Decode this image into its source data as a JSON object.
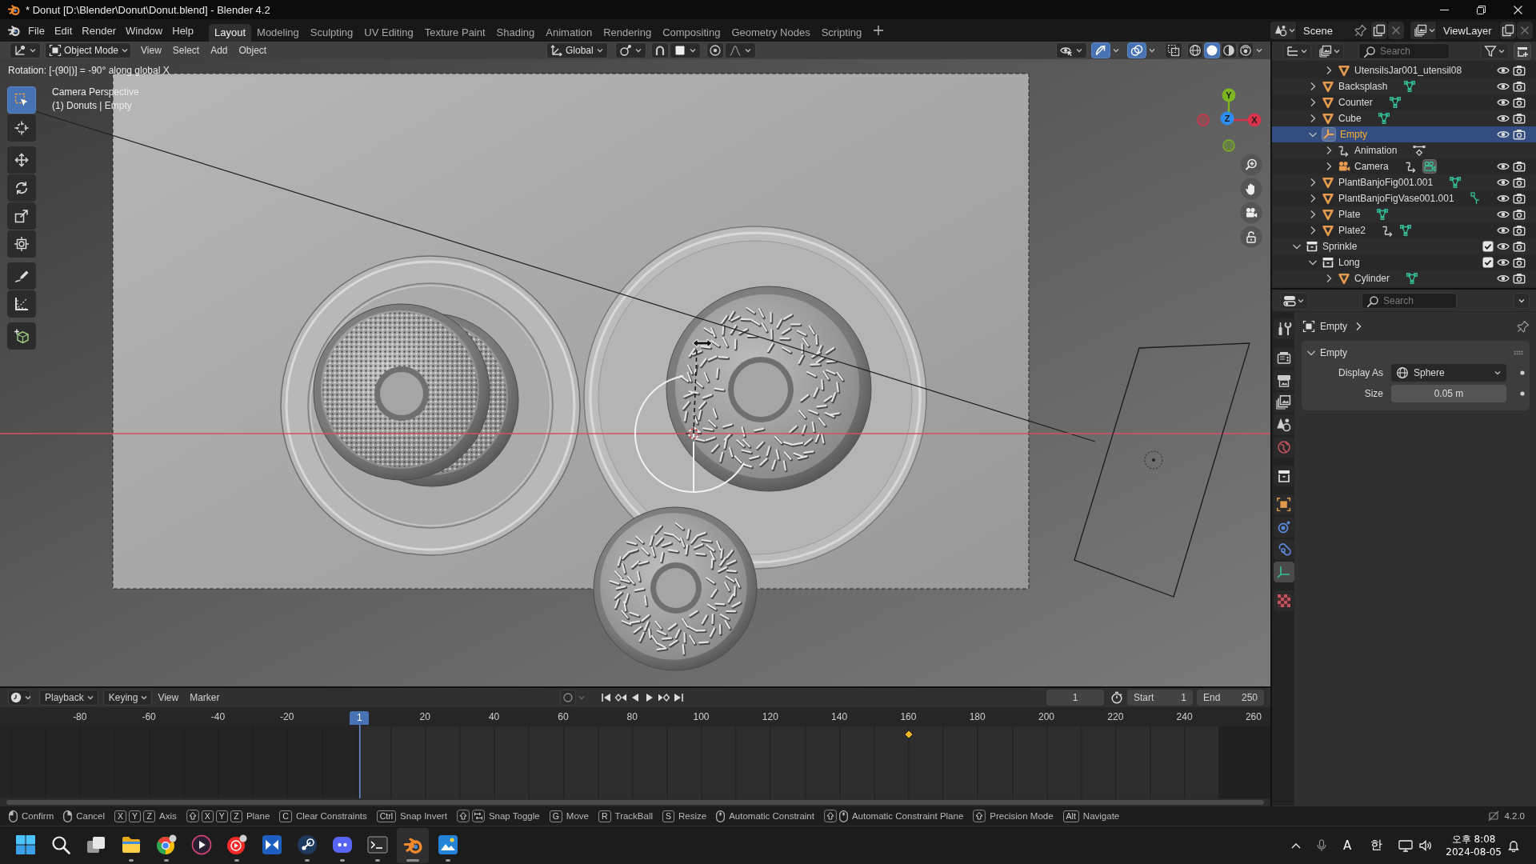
{
  "window": {
    "title": "* Donut [D:\\Blender\\Donut\\Donut.blend] - Blender 4.2"
  },
  "menu": [
    "File",
    "Edit",
    "Render",
    "Window",
    "Help"
  ],
  "workspaces": [
    {
      "label": "Layout",
      "selected": true
    },
    {
      "label": "Modeling",
      "selected": false
    },
    {
      "label": "Sculpting",
      "selected": false
    },
    {
      "label": "UV Editing",
      "selected": false
    },
    {
      "label": "Texture Paint",
      "selected": false
    },
    {
      "label": "Shading",
      "selected": false
    },
    {
      "label": "Animation",
      "selected": false
    },
    {
      "label": "Rendering",
      "selected": false
    },
    {
      "label": "Compositing",
      "selected": false
    },
    {
      "label": "Geometry Nodes",
      "selected": false
    },
    {
      "label": "Scripting",
      "selected": false
    }
  ],
  "scene": {
    "name": "Scene"
  },
  "view_layer": {
    "name": "ViewLayer"
  },
  "viewport": {
    "mode": "Object Mode",
    "menus": [
      "View",
      "Select",
      "Add",
      "Object"
    ],
    "orientation": "Global",
    "toggles": [
      {
        "kind": "snap",
        "on": false
      },
      {
        "kind": "proportional",
        "on": false
      },
      {
        "kind": "gizmos",
        "on": true
      },
      {
        "kind": "overlays",
        "on": true
      },
      {
        "kind": "xray",
        "on": false
      }
    ],
    "shading": [
      {
        "kind": "wireframe",
        "selected": false
      },
      {
        "kind": "solid",
        "selected": true
      },
      {
        "kind": "material",
        "selected": false
      },
      {
        "kind": "rendered",
        "selected": false
      }
    ],
    "operator_status": "Rotation: [-(90|)] = -90° along global X",
    "info": [
      "Camera Perspective",
      "(1) Donuts | Empty"
    ],
    "tools": [
      {
        "kind": "select",
        "selected": true
      },
      {
        "kind": "cursor",
        "selected": false
      },
      {
        "kind": "move",
        "selected": false
      },
      {
        "kind": "rotate",
        "selected": false
      },
      {
        "kind": "scale",
        "selected": false
      },
      {
        "kind": "transform",
        "selected": false
      },
      {
        "kind": "annotate",
        "selected": false
      },
      {
        "kind": "measure",
        "selected": false
      },
      {
        "kind": "add_cube",
        "selected": false
      }
    ],
    "axes": [
      {
        "kind": "y",
        "label": "Y",
        "color": "#7cb51f"
      },
      {
        "kind": "z",
        "label": "Z",
        "color": "#2d8cf0"
      },
      {
        "kind": "x",
        "label": "X",
        "color": "#d7344b"
      }
    ]
  },
  "outliner": {
    "search_placeholder": "Search",
    "items": [
      {
        "children": [
          {
            "children": [
              {
                "name": "UtensilsJar001_utensil08",
                "kind": "mesh",
                "expanded": false,
                "selected": false
              }
            ]
          },
          {
            "name": "Backsplash",
            "kind": "mesh",
            "expanded": false,
            "selected": false,
            "extras": [
              {
                "kind": "mesh_data"
              }
            ]
          },
          {
            "name": "Counter",
            "kind": "mesh",
            "expanded": false,
            "selected": false,
            "extras": [
              {
                "kind": "mesh_data"
              }
            ]
          },
          {
            "name": "Cube",
            "kind": "mesh",
            "expanded": false,
            "selected": false,
            "extras": [
              {
                "kind": "mesh_data"
              }
            ]
          },
          {
            "name": "Empty",
            "kind": "empty",
            "expanded": true,
            "selected": true,
            "children": [
              {
                "name": "Animation",
                "kind": "animation",
                "expanded": false,
                "selected": false,
                "extras": [
                  {
                    "kind": "action"
                  }
                ]
              },
              {
                "name": "Camera",
                "kind": "camera",
                "expanded": false,
                "selected": false,
                "extras": [
                  {
                    "kind": "link"
                  },
                  {
                    "kind": "camera_data"
                  }
                ]
              }
            ]
          },
          {
            "name": "PlantBanjoFig001.001",
            "kind": "mesh",
            "expanded": false,
            "selected": false,
            "extras": [
              {
                "kind": "mesh_data"
              }
            ]
          },
          {
            "name": "PlantBanjoFigVase001.001",
            "kind": "mesh",
            "expanded": false,
            "selected": false,
            "extras": [
              {
                "kind": "bone"
              }
            ]
          },
          {
            "name": "Plate",
            "kind": "mesh",
            "expanded": false,
            "selected": false,
            "extras": [
              {
                "kind": "mesh_data"
              }
            ]
          },
          {
            "name": "Plate2",
            "kind": "mesh",
            "expanded": false,
            "selected": false,
            "extras": [
              {
                "kind": "link"
              },
              {
                "kind": "mesh_data"
              }
            ]
          }
        ]
      },
      {
        "name": "Sprinkle",
        "kind": "collection",
        "expanded": true,
        "selected": false,
        "checked": true,
        "children": [
          {
            "name": "Long",
            "kind": "collection",
            "expanded": true,
            "selected": false,
            "checked": true,
            "children": [
              {
                "name": "Cylinder",
                "kind": "mesh",
                "expanded": false,
                "selected": false,
                "extras": [
                  {
                    "kind": "mesh_data"
                  }
                ]
              }
            ]
          }
        ]
      }
    ]
  },
  "properties": {
    "search_placeholder": "Search",
    "tabs": [
      {
        "kind": "tool",
        "selected": false
      },
      {
        "kind": "render",
        "selected": false
      },
      {
        "kind": "output",
        "selected": false
      },
      {
        "kind": "view_layer",
        "selected": false
      },
      {
        "kind": "scene",
        "selected": false
      },
      {
        "kind": "world",
        "selected": false
      },
      {
        "kind": "collection",
        "selected": false
      },
      {
        "kind": "object",
        "selected": false
      },
      {
        "kind": "physics",
        "selected": false
      },
      {
        "kind": "constraints",
        "selected": false
      },
      {
        "kind": "data",
        "selected": true
      },
      {
        "kind": "texture",
        "selected": false
      }
    ],
    "context": "Empty",
    "panels": [
      {
        "title": "Empty",
        "expanded": true,
        "fields": [
          {
            "label": "Display As",
            "kind": "dropdown",
            "value": "Sphere"
          },
          {
            "label": "Size",
            "kind": "number",
            "value": "0.05 m"
          }
        ]
      }
    ]
  },
  "timeline": {
    "menus": [
      {
        "label": "Playback",
        "kind": "dropdown"
      },
      {
        "label": "Keying",
        "kind": "dropdown"
      },
      {
        "label": "View",
        "kind": "menu"
      },
      {
        "label": "Marker",
        "kind": "menu"
      }
    ],
    "auto_keying": {
      "on": false
    },
    "current_frame": "1",
    "start": {
      "label": "Start",
      "value": "1"
    },
    "end": {
      "label": "End",
      "value": "250"
    },
    "ruler": [
      "-80",
      "-60",
      "-40",
      "-20",
      "20",
      "40",
      "60",
      "80",
      "100",
      "120",
      "140",
      "160",
      "180",
      "200",
      "220",
      "240",
      "260"
    ],
    "playhead": "1"
  },
  "status_bar": {
    "hints": [
      {
        "keys": [
          {
            "kind": "mouse_left"
          }
        ],
        "label": "Confirm"
      },
      {
        "keys": [
          {
            "kind": "mouse_right"
          }
        ],
        "label": "Cancel"
      },
      {
        "keys": [
          {
            "kind": "key",
            "text": "X"
          },
          {
            "kind": "key",
            "text": "Y"
          },
          {
            "kind": "key",
            "text": "Z"
          }
        ],
        "label": "Axis"
      },
      {
        "keys": [
          {
            "kind": "shift"
          },
          {
            "kind": "key",
            "text": "X"
          },
          {
            "kind": "key",
            "text": "Y"
          },
          {
            "kind": "key",
            "text": "Z"
          }
        ],
        "label": "Plane"
      },
      {
        "keys": [
          {
            "kind": "key",
            "text": "C"
          }
        ],
        "label": "Clear Constraints"
      },
      {
        "keys": [
          {
            "kind": "key",
            "text": "Ctrl"
          }
        ],
        "label": "Snap Invert"
      },
      {
        "keys": [
          {
            "kind": "shift"
          },
          {
            "kind": "tab"
          }
        ],
        "label": "Snap Toggle"
      },
      {
        "keys": [
          {
            "kind": "key",
            "text": "G"
          }
        ],
        "label": "Move"
      },
      {
        "keys": [
          {
            "kind": "key",
            "text": "R"
          }
        ],
        "label": "TrackBall"
      },
      {
        "keys": [
          {
            "kind": "key",
            "text": "S"
          }
        ],
        "label": "Resize"
      },
      {
        "keys": [
          {
            "kind": "mouse_middle"
          }
        ],
        "label": "Automatic Constraint"
      },
      {
        "keys": [
          {
            "kind": "shift"
          },
          {
            "kind": "mouse_middle"
          }
        ],
        "label": "Automatic Constraint Plane"
      },
      {
        "keys": [
          {
            "kind": "shift"
          }
        ],
        "label": "Precision Mode"
      },
      {
        "keys": [
          {
            "kind": "key",
            "text": "Alt"
          }
        ],
        "label": "Navigate"
      }
    ],
    "version": "4.2.0"
  },
  "taskbar": {
    "apps": [
      {
        "kind": "start",
        "running": false,
        "active": false
      },
      {
        "kind": "search",
        "running": false,
        "active": false
      },
      {
        "kind": "task_view",
        "running": false,
        "active": false
      },
      {
        "kind": "files",
        "running": true,
        "active": false
      },
      {
        "kind": "browser",
        "running": true,
        "active": false
      },
      {
        "kind": "media_player",
        "running": false,
        "active": false
      },
      {
        "kind": "music",
        "running": true,
        "active": false
      },
      {
        "kind": "tile_app",
        "running": false,
        "active": false
      },
      {
        "kind": "game_store",
        "running": true,
        "active": false
      },
      {
        "kind": "chat",
        "running": true,
        "active": false
      },
      {
        "kind": "terminal",
        "running": true,
        "active": false
      },
      {
        "kind": "blender",
        "running": true,
        "active": true
      },
      {
        "kind": "paint",
        "running": true,
        "active": false
      }
    ],
    "input_mode": "A",
    "ime": "한",
    "time": "오후 8:08",
    "date": "2024-08-05"
  }
}
